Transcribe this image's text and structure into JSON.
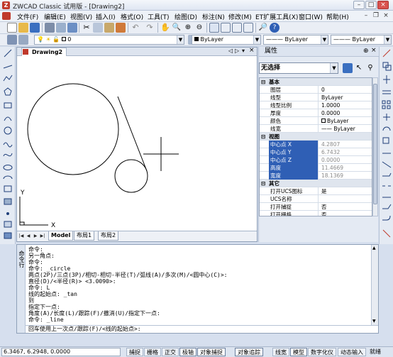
{
  "window": {
    "title": "ZWCAD Classic 试用版 - [Drawing2]",
    "app_icon": "Z"
  },
  "menubar": {
    "items": [
      "文件(F)",
      "编辑(E)",
      "视图(V)",
      "插入(I)",
      "格式(O)",
      "工具(T)",
      "绘图(D)",
      "标注(N)",
      "修改(M)",
      "ET扩展工具(X)",
      "窗口(W)",
      "帮助(H)"
    ]
  },
  "toolbar2": {
    "layer_value": "0",
    "color_value": "ByLayer",
    "linetype_value": "ByLayer",
    "lineweight_value": "ByLayer"
  },
  "document": {
    "tab_label": "Drawing2",
    "axis_x": "X",
    "axis_y": "Y"
  },
  "layout_tabs": [
    "Model",
    "布局1",
    "布局2"
  ],
  "properties": {
    "title": "属性",
    "selection": "无选择",
    "categories": {
      "basic": "基本",
      "view": "视图",
      "other": "其它"
    },
    "basic_rows": [
      {
        "label": "图层",
        "value": "0"
      },
      {
        "label": "线型",
        "value": "ByLayer"
      },
      {
        "label": "线型比例",
        "value": "1.0000"
      },
      {
        "label": "厚度",
        "value": "0.0000"
      },
      {
        "label": "颜色",
        "value": "ByLayer"
      },
      {
        "label": "线宽",
        "value": "ByLayer"
      }
    ],
    "view_rows": [
      {
        "label": "中心点 X",
        "value": "4.2807"
      },
      {
        "label": "中心点 Y",
        "value": "6.7432"
      },
      {
        "label": "中心点 Z",
        "value": "0.0000"
      },
      {
        "label": "高度",
        "value": "11.4669"
      },
      {
        "label": "宽度",
        "value": "18.1369"
      }
    ],
    "other_rows": [
      {
        "label": "打开UCS图标",
        "value": "是"
      },
      {
        "label": "UCS名称",
        "value": ""
      },
      {
        "label": "打开捕捉",
        "value": "否"
      },
      {
        "label": "打开栅格",
        "value": "否"
      }
    ]
  },
  "command": {
    "side_label": "命令行",
    "lines": [
      "命令:",
      "另一角点:",
      "命令:",
      "命令: _circle",
      "两点(2P)/三点(3P)/相切-相切-半径(T)/弧线(A)/多次(M)/<圆中心(C)>:",
      "直径(D)/<半径(R)> <3.0090>:",
      "命令: L",
      "线的起始点: _tan",
      "到",
      "指定下一点:",
      "角度(A)/长度(L)/跟踪(F)/撤消(U)/指定下一点:",
      "命令: _line"
    ],
    "input": "回车使用上一次点/跟踪(F)/<线的起始点>:"
  },
  "status": {
    "coords": "6.3467, 6.2948, 0.0000",
    "buttons": [
      "捕捉",
      "栅格",
      "正交",
      "极轴",
      "对象捕捉",
      "对象追踪",
      "线宽",
      "模型",
      "数字化仪",
      "动态输入",
      "就绪"
    ]
  },
  "colors": {
    "accent": "#2f5fb5",
    "frame": "#d6dfee"
  }
}
